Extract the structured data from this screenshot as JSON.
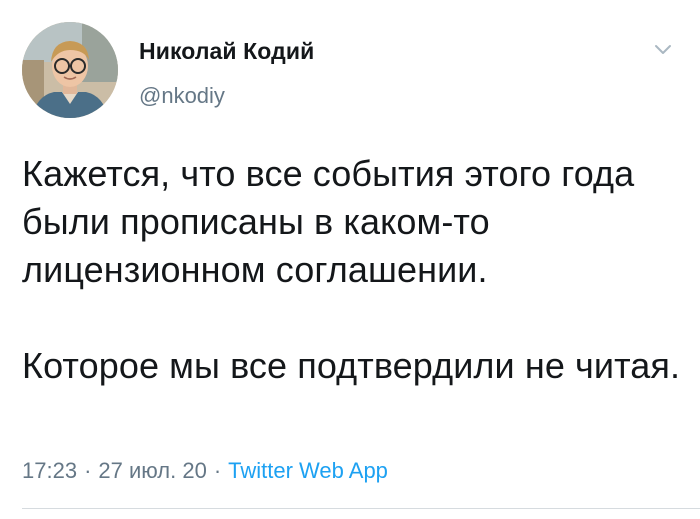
{
  "author": {
    "name": "Николай Кодий",
    "handle": "@nkodiy",
    "avatar_icon": "user-photo"
  },
  "menu": {
    "icon": "chevron-down-icon",
    "color": "#aab8c2"
  },
  "tweet": {
    "text": "Кажется, что все события этого года были прописаны в каком-то лицензионном соглашении.\n\nКоторое мы все подтвердили не читая."
  },
  "meta": {
    "time": "17:23",
    "separator": "·",
    "date": "27 июл. 20",
    "source": "Twitter Web App"
  },
  "colors": {
    "text": "#14171a",
    "secondary": "#657786",
    "link": "#1da1f2",
    "divider": "#d6dbdf"
  }
}
